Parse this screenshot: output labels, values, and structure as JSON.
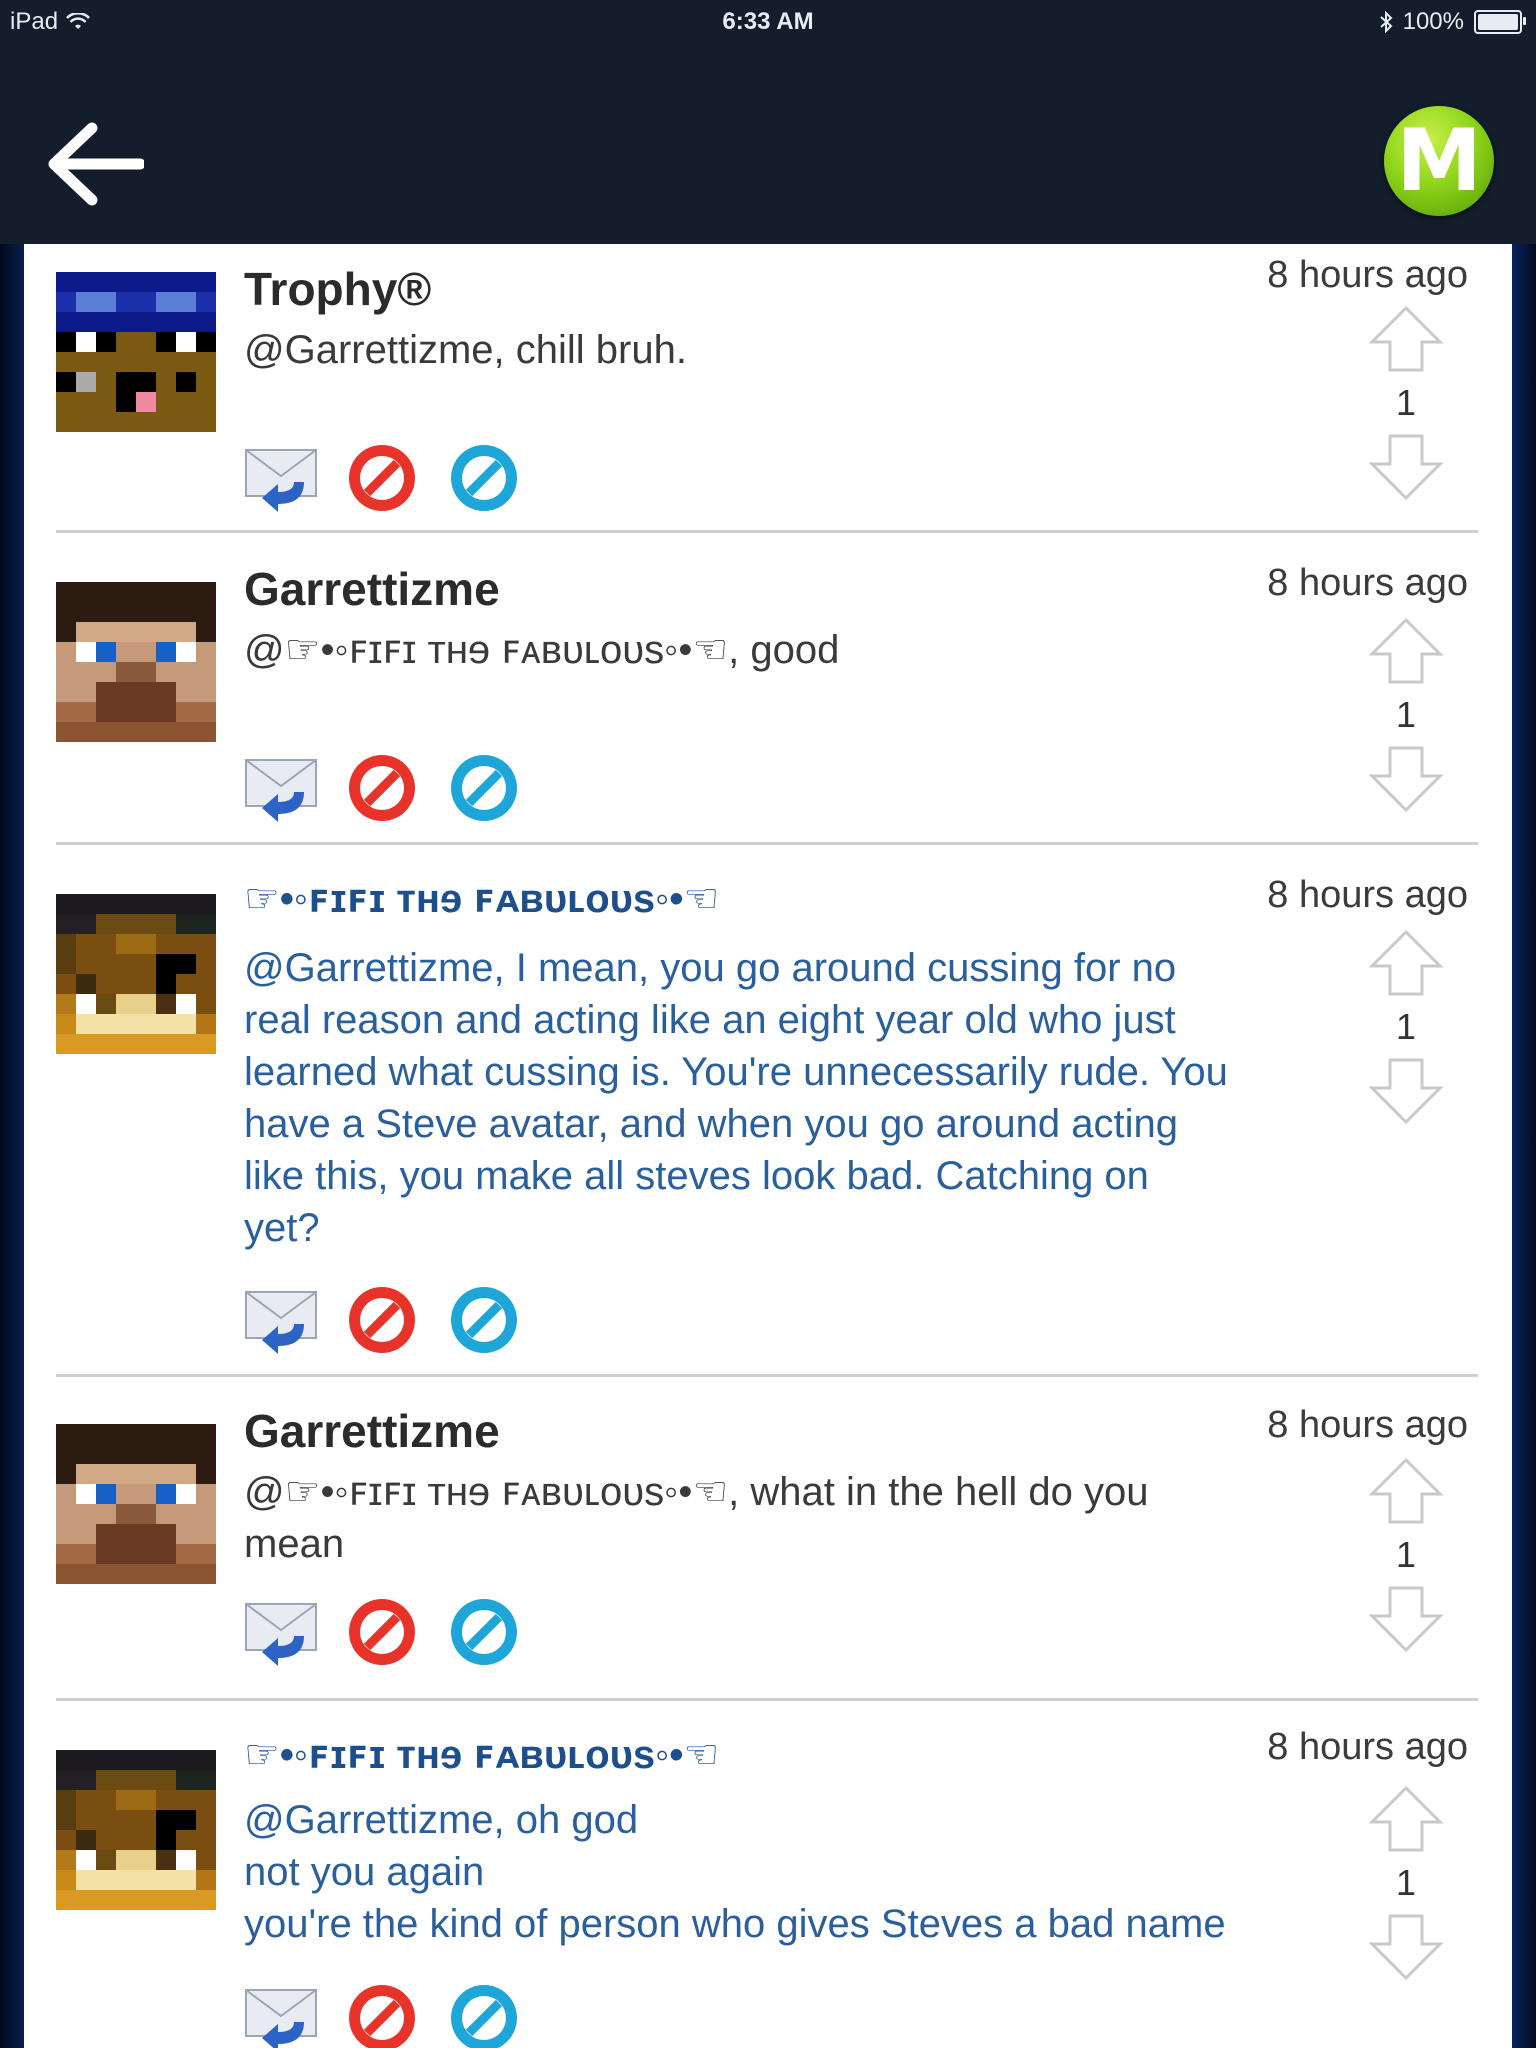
{
  "status_bar": {
    "device": "iPad",
    "time": "6:33 AM",
    "battery": "100%"
  },
  "nav": {
    "back_icon": "back-arrow-icon",
    "logo_letter": "M"
  },
  "posts": [
    {
      "username": "Trophy®",
      "timestamp": "8 hours ago",
      "message": "@Garrettizme, chill bruh.",
      "votes": "1"
    },
    {
      "username": "Garrettizme",
      "timestamp": "8 hours ago",
      "message": "@☞•◦ꜰɪꜰɪ ᴛʜɘ ꜰᴀʙᴜʟᴏᴜs◦•☜, good",
      "votes": "1"
    },
    {
      "username": "☞•◦ꜰɪꜰɪ ᴛʜɘ ꜰᴀʙᴜʟᴏᴜs◦•☜",
      "timestamp": "8 hours ago",
      "message_lines": [
        "@Garrettizme, I mean, you go around cussing for no",
        "real reason and acting like an eight year old who just",
        "learned what cussing is. You're unnecessarily rude. You",
        "have a Steve avatar, and when you go around acting",
        "like this, you make all steves look bad. Catching on",
        "yet?"
      ],
      "votes": "1"
    },
    {
      "username": "Garrettizme",
      "timestamp": "8 hours ago",
      "message_lines": [
        "@☞•◦ꜰɪꜰɪ ᴛʜɘ ꜰᴀʙᴜʟᴏᴜs◦•☜, what in the hell do you",
        "mean"
      ],
      "votes": "1"
    },
    {
      "username": "☞•◦ꜰɪꜰɪ ᴛʜɘ ꜰᴀʙᴜʟᴏᴜs◦•☜",
      "timestamp": "8 hours ago",
      "message_lines": [
        "@Garrettizme, oh god",
        "not you again",
        "you're the kind of person who gives Steves a bad name"
      ],
      "votes": "1"
    }
  ],
  "icons": {
    "reply": "reply-envelope-icon",
    "block": "block-red-icon",
    "mute": "block-blue-icon",
    "upvote": "upvote-arrow-icon",
    "downvote": "downvote-arrow-icon"
  }
}
